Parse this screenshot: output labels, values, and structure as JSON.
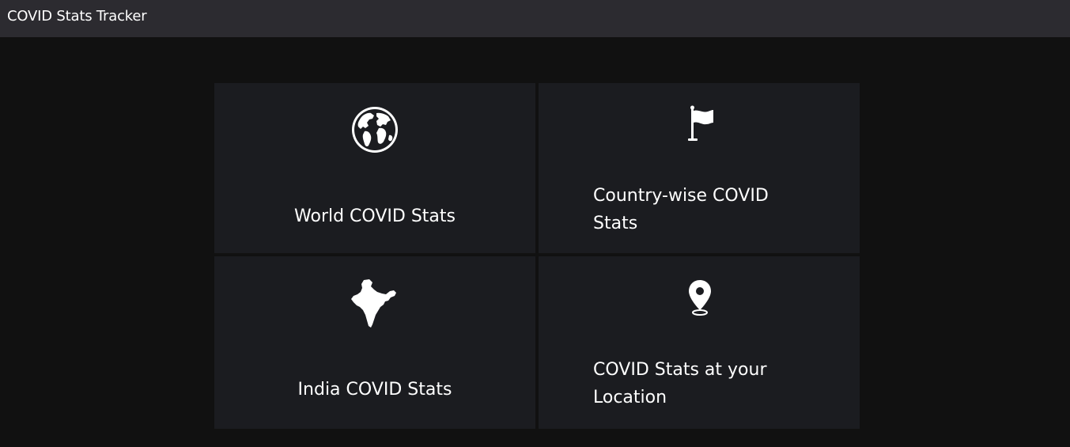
{
  "header": {
    "title": "COVID Stats Tracker"
  },
  "cards": [
    {
      "label": "World COVID Stats",
      "icon": "globe-icon"
    },
    {
      "label": "Country-wise COVID Stats",
      "icon": "flag-icon"
    },
    {
      "label": "India COVID Stats",
      "icon": "india-map-icon"
    },
    {
      "label": "COVID Stats at your Location",
      "icon": "location-pin-icon"
    }
  ],
  "colors": {
    "background": "#111111",
    "header": "#2c2b30",
    "card": "#1b1c20",
    "text": "#ffffff"
  }
}
